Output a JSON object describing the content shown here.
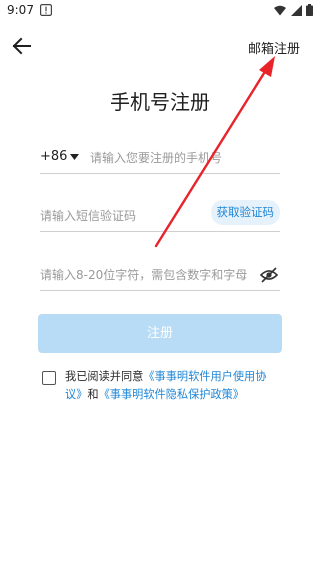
{
  "status_bar": {
    "time": "9:07"
  },
  "header": {
    "email_register": "邮箱注册"
  },
  "title": "手机号注册",
  "phone": {
    "country_code": "+86",
    "placeholder": "请输入您要注册的手机号"
  },
  "code": {
    "placeholder": "请输入短信验证码",
    "get_code_label": "获取验证码"
  },
  "password": {
    "placeholder": "请输入8-20位字符，需包含数字和字母"
  },
  "register_button": "注册",
  "agreement": {
    "prefix": "我已阅读并同意",
    "user_agreement": "《事事明软件用户使用协议》",
    "and": "和",
    "privacy_policy": "《事事明软件隐私保护政策》"
  },
  "colors": {
    "accent": "#1e86d6",
    "button_disabled": "#b8dcf6",
    "annotation": "#e8232a"
  },
  "icons": [
    "warning-icon",
    "wifi-icon",
    "signal-icon",
    "battery-icon",
    "back-arrow-icon",
    "caret-down-icon",
    "eye-off-icon"
  ]
}
